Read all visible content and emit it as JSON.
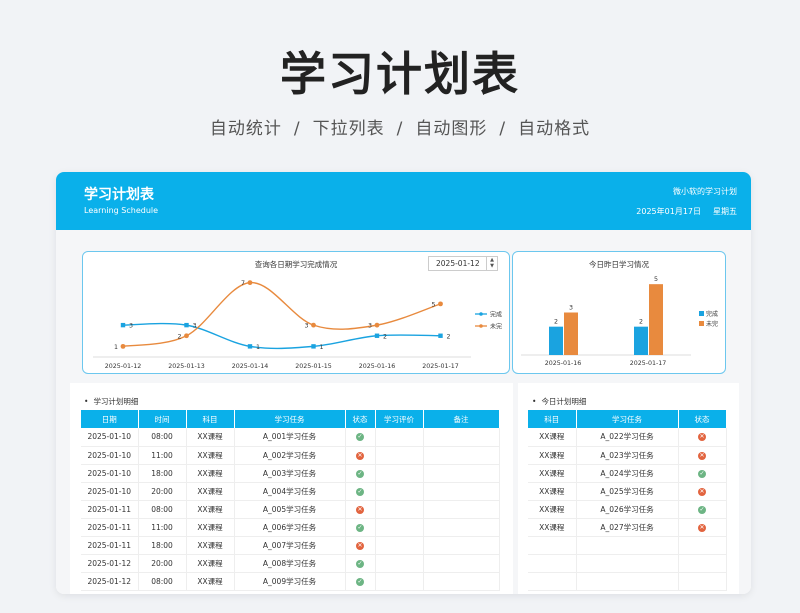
{
  "hero": {
    "title": "学习计划表",
    "features": [
      "自动统计",
      "下拉列表",
      "自动图形",
      "自动格式"
    ],
    "separator": "/"
  },
  "banner": {
    "title": "学习计划表",
    "subtitle": "Learning Schedule",
    "author": "微小软的学习计划",
    "date": "2025年01月17日",
    "weekday": "星期五"
  },
  "colors": {
    "accent": "#0ab0ea",
    "done": "#1aa3e0",
    "undone": "#e88a3e",
    "ok": "#6db584",
    "no": "#e2643f"
  },
  "chart1": {
    "title": "查询各日期学习完成情况",
    "date_input": "2025-01-12"
  },
  "chart2": {
    "title": "今日昨日学习情况"
  },
  "chart_data": [
    {
      "type": "line",
      "title": "查询各日期学习完成情况",
      "categories": [
        "2025-01-12",
        "2025-01-13",
        "2025-01-14",
        "2025-01-15",
        "2025-01-16",
        "2025-01-17"
      ],
      "series": [
        {
          "name": "完成",
          "values": [
            3,
            3,
            1,
            1,
            2,
            2
          ]
        },
        {
          "name": "未完",
          "values": [
            1,
            2,
            7,
            3,
            3,
            5
          ]
        }
      ],
      "ylim": [
        0,
        8
      ],
      "legend": "right"
    },
    {
      "type": "bar",
      "title": "今日昨日学习情况",
      "categories": [
        "2025-01-16",
        "2025-01-17"
      ],
      "series": [
        {
          "name": "完成",
          "values": [
            2,
            2
          ]
        },
        {
          "name": "未完",
          "values": [
            3,
            5
          ]
        }
      ],
      "ylim": [
        0,
        6
      ],
      "legend": "right"
    }
  ],
  "schedule": {
    "title": "学习计划明细",
    "headers": [
      "日期",
      "时间",
      "科目",
      "学习任务",
      "状态",
      "学习评价",
      "备注"
    ],
    "rows": [
      {
        "date": "2025-01-10",
        "time": "08:00",
        "subject": "XX课程",
        "task": "A_001学习任务",
        "status": "ok"
      },
      {
        "date": "2025-01-10",
        "time": "11:00",
        "subject": "XX课程",
        "task": "A_002学习任务",
        "status": "no"
      },
      {
        "date": "2025-01-10",
        "time": "18:00",
        "subject": "XX课程",
        "task": "A_003学习任务",
        "status": "ok"
      },
      {
        "date": "2025-01-10",
        "time": "20:00",
        "subject": "XX课程",
        "task": "A_004学习任务",
        "status": "ok"
      },
      {
        "date": "2025-01-11",
        "time": "08:00",
        "subject": "XX课程",
        "task": "A_005学习任务",
        "status": "no"
      },
      {
        "date": "2025-01-11",
        "time": "11:00",
        "subject": "XX课程",
        "task": "A_006学习任务",
        "status": "ok"
      },
      {
        "date": "2025-01-11",
        "time": "18:00",
        "subject": "XX课程",
        "task": "A_007学习任务",
        "status": "no"
      },
      {
        "date": "2025-01-12",
        "time": "20:00",
        "subject": "XX课程",
        "task": "A_008学习任务",
        "status": "ok"
      },
      {
        "date": "2025-01-12",
        "time": "08:00",
        "subject": "XX课程",
        "task": "A_009学习任务",
        "status": "ok"
      }
    ]
  },
  "today": {
    "title": "今日计划明细",
    "headers": [
      "科目",
      "学习任务",
      "状态"
    ],
    "rows": [
      {
        "subject": "XX课程",
        "task": "A_022学习任务",
        "status": "no"
      },
      {
        "subject": "XX课程",
        "task": "A_023学习任务",
        "status": "no"
      },
      {
        "subject": "XX课程",
        "task": "A_024学习任务",
        "status": "ok"
      },
      {
        "subject": "XX课程",
        "task": "A_025学习任务",
        "status": "no"
      },
      {
        "subject": "XX课程",
        "task": "A_026学习任务",
        "status": "ok"
      },
      {
        "subject": "XX课程",
        "task": "A_027学习任务",
        "status": "no"
      }
    ]
  }
}
